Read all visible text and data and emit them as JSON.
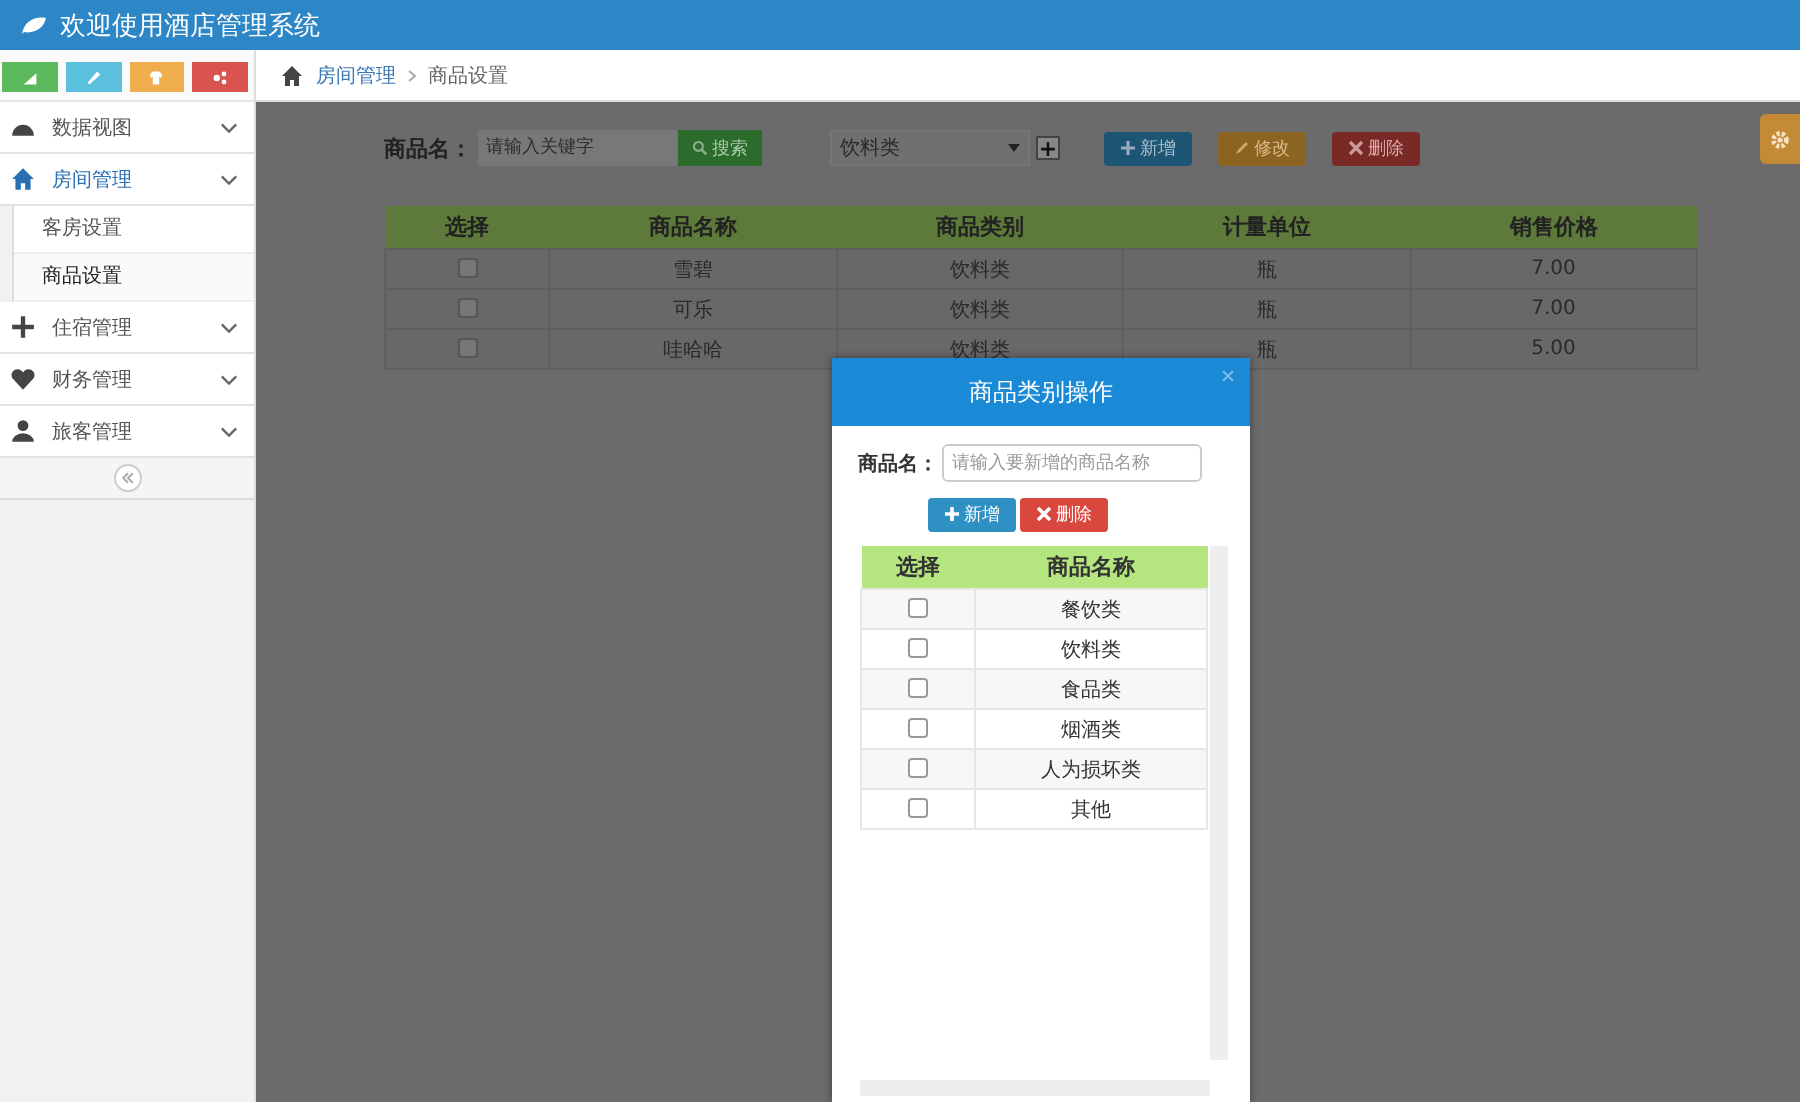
{
  "header": {
    "title": "欢迎使用酒店管理系统"
  },
  "sidebar": {
    "shortcuts": [
      {
        "color": "#5cb85c"
      },
      {
        "color": "#5bc0de"
      },
      {
        "color": "#f0ad4e"
      },
      {
        "color": "#d9534f"
      }
    ],
    "menu": [
      {
        "label": "数据视图",
        "selected": false
      },
      {
        "label": "房间管理",
        "selected": true,
        "children": [
          {
            "label": "客房设置",
            "selected": false
          },
          {
            "label": "商品设置",
            "selected": true
          }
        ]
      },
      {
        "label": "住宿管理",
        "selected": false
      },
      {
        "label": "财务管理",
        "selected": false
      },
      {
        "label": "旅客管理",
        "selected": false
      }
    ]
  },
  "breadcrumb": [
    "房间管理",
    "商品设置"
  ],
  "toolbar": {
    "label": "商品名：",
    "placeholder": "请输入关键字",
    "search_button": "搜索",
    "category": "饮料类",
    "add_category": "+",
    "buttons": [
      {
        "label": "新增",
        "kind": "add"
      },
      {
        "label": "修改",
        "kind": "edit"
      },
      {
        "label": "删除",
        "kind": "delete"
      }
    ]
  },
  "table": {
    "columns": [
      "选择",
      "商品名称",
      "商品类别",
      "计量单位",
      "销售价格"
    ],
    "rows": [
      {
        "checked": false,
        "name": "雪碧",
        "category": "饮料类",
        "unit": "瓶",
        "price": "7.00"
      },
      {
        "checked": false,
        "name": "可乐",
        "category": "饮料类",
        "unit": "瓶",
        "price": "7.00"
      },
      {
        "checked": false,
        "name": "哇哈哈",
        "category": "饮料类",
        "unit": "瓶",
        "price": "5.00"
      }
    ]
  },
  "modal": {
    "title": "商品类别操作",
    "label": "商品名：",
    "placeholder": "请输入要新增的商品名称",
    "buttons": [
      {
        "label": "新增",
        "kind": "add"
      },
      {
        "label": "删除",
        "kind": "delete"
      }
    ],
    "columns": [
      "选择",
      "商品名称"
    ],
    "rows": [
      {
        "checked": false,
        "name": "餐饮类"
      },
      {
        "checked": false,
        "name": "饮料类"
      },
      {
        "checked": false,
        "name": "食品类"
      },
      {
        "checked": false,
        "name": "烟酒类"
      },
      {
        "checked": false,
        "name": "人为损坏类"
      },
      {
        "checked": false,
        "name": "其他"
      }
    ]
  }
}
